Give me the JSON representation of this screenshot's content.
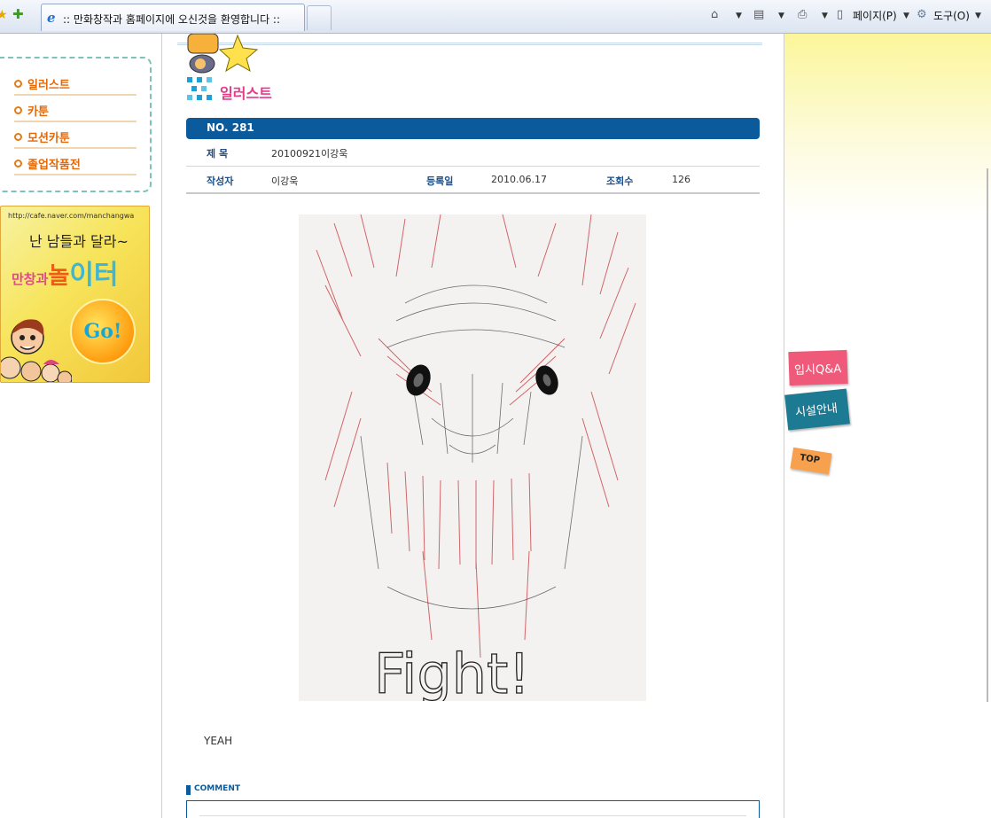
{
  "browser": {
    "tab_title": ":: 만화창작과 홈페이지에 오신것을 환영합니다 ::",
    "toolbar": {
      "page_label": "페이지(P)",
      "tools_label": "도구(O)"
    }
  },
  "sidebar": {
    "menu": [
      {
        "label": "일러스트"
      },
      {
        "label": "카툰"
      },
      {
        "label": "모션카툰"
      },
      {
        "label": "졸업작품전"
      }
    ],
    "banner": {
      "url": "http://cafe.naver.com/manchangwa",
      "slogan": "난 남들과 달라~",
      "brand_1": "만창과",
      "brand_2": "놀",
      "brand_3": "이터",
      "go": "Go!"
    }
  },
  "main": {
    "section_title": "일러스트",
    "post": {
      "no_label": "NO. 281",
      "subject_label": "제  목",
      "subject": "20100921이강욱",
      "author_label": "작성자",
      "author": "이강욱",
      "date_label": "등록일",
      "date": "2010.06.17",
      "views_label": "조회수",
      "views": "126",
      "artwork_text": "Fight!",
      "body": "YEAH"
    },
    "comment_label": "COMMENT"
  },
  "right_tabs": {
    "qa": "입시Q&A",
    "facility": "시설안내",
    "top": "TOP"
  }
}
